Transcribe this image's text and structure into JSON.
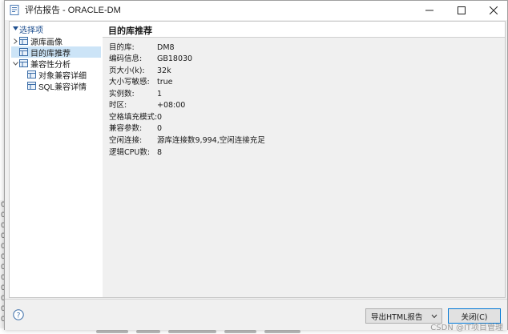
{
  "window": {
    "title": "评估报告 - ORACLE-DM"
  },
  "nav": {
    "root_label": "选择项",
    "items": [
      {
        "label": "源库画像",
        "expanded": false
      },
      {
        "label": "目的库推荐",
        "selected": true
      },
      {
        "label": "兼容性分析",
        "expanded": true
      },
      {
        "label": "对象兼容详细"
      },
      {
        "label": "SQL兼容详情"
      }
    ]
  },
  "content": {
    "title": "目的库推荐",
    "rows": [
      {
        "key": "目的库:",
        "value": "DM8"
      },
      {
        "key": "编码信息:",
        "value": "GB18030"
      },
      {
        "key": "页大小(k):",
        "value": "32k"
      },
      {
        "key": "大小写敏感:",
        "value": "true"
      },
      {
        "key": "实例数:",
        "value": "1"
      },
      {
        "key": "时区:",
        "value": "+08:00"
      },
      {
        "key": "空格填充模式:",
        "value": "0"
      },
      {
        "key": "兼容参数:",
        "value": "0"
      },
      {
        "key": "空闲连接:",
        "value": "源库连接数9,994,空闲连接充足"
      },
      {
        "key": "逻辑CPU数:",
        "value": "8"
      }
    ]
  },
  "footer": {
    "export_label": "导出HTML报告",
    "close_label": "关闭(C)"
  },
  "watermark": "CSDN @IT项目管理",
  "colors": {
    "selected_bg": "#cce4f7",
    "section_blue": "#1f4f8f",
    "focus_border": "#0078d7"
  }
}
